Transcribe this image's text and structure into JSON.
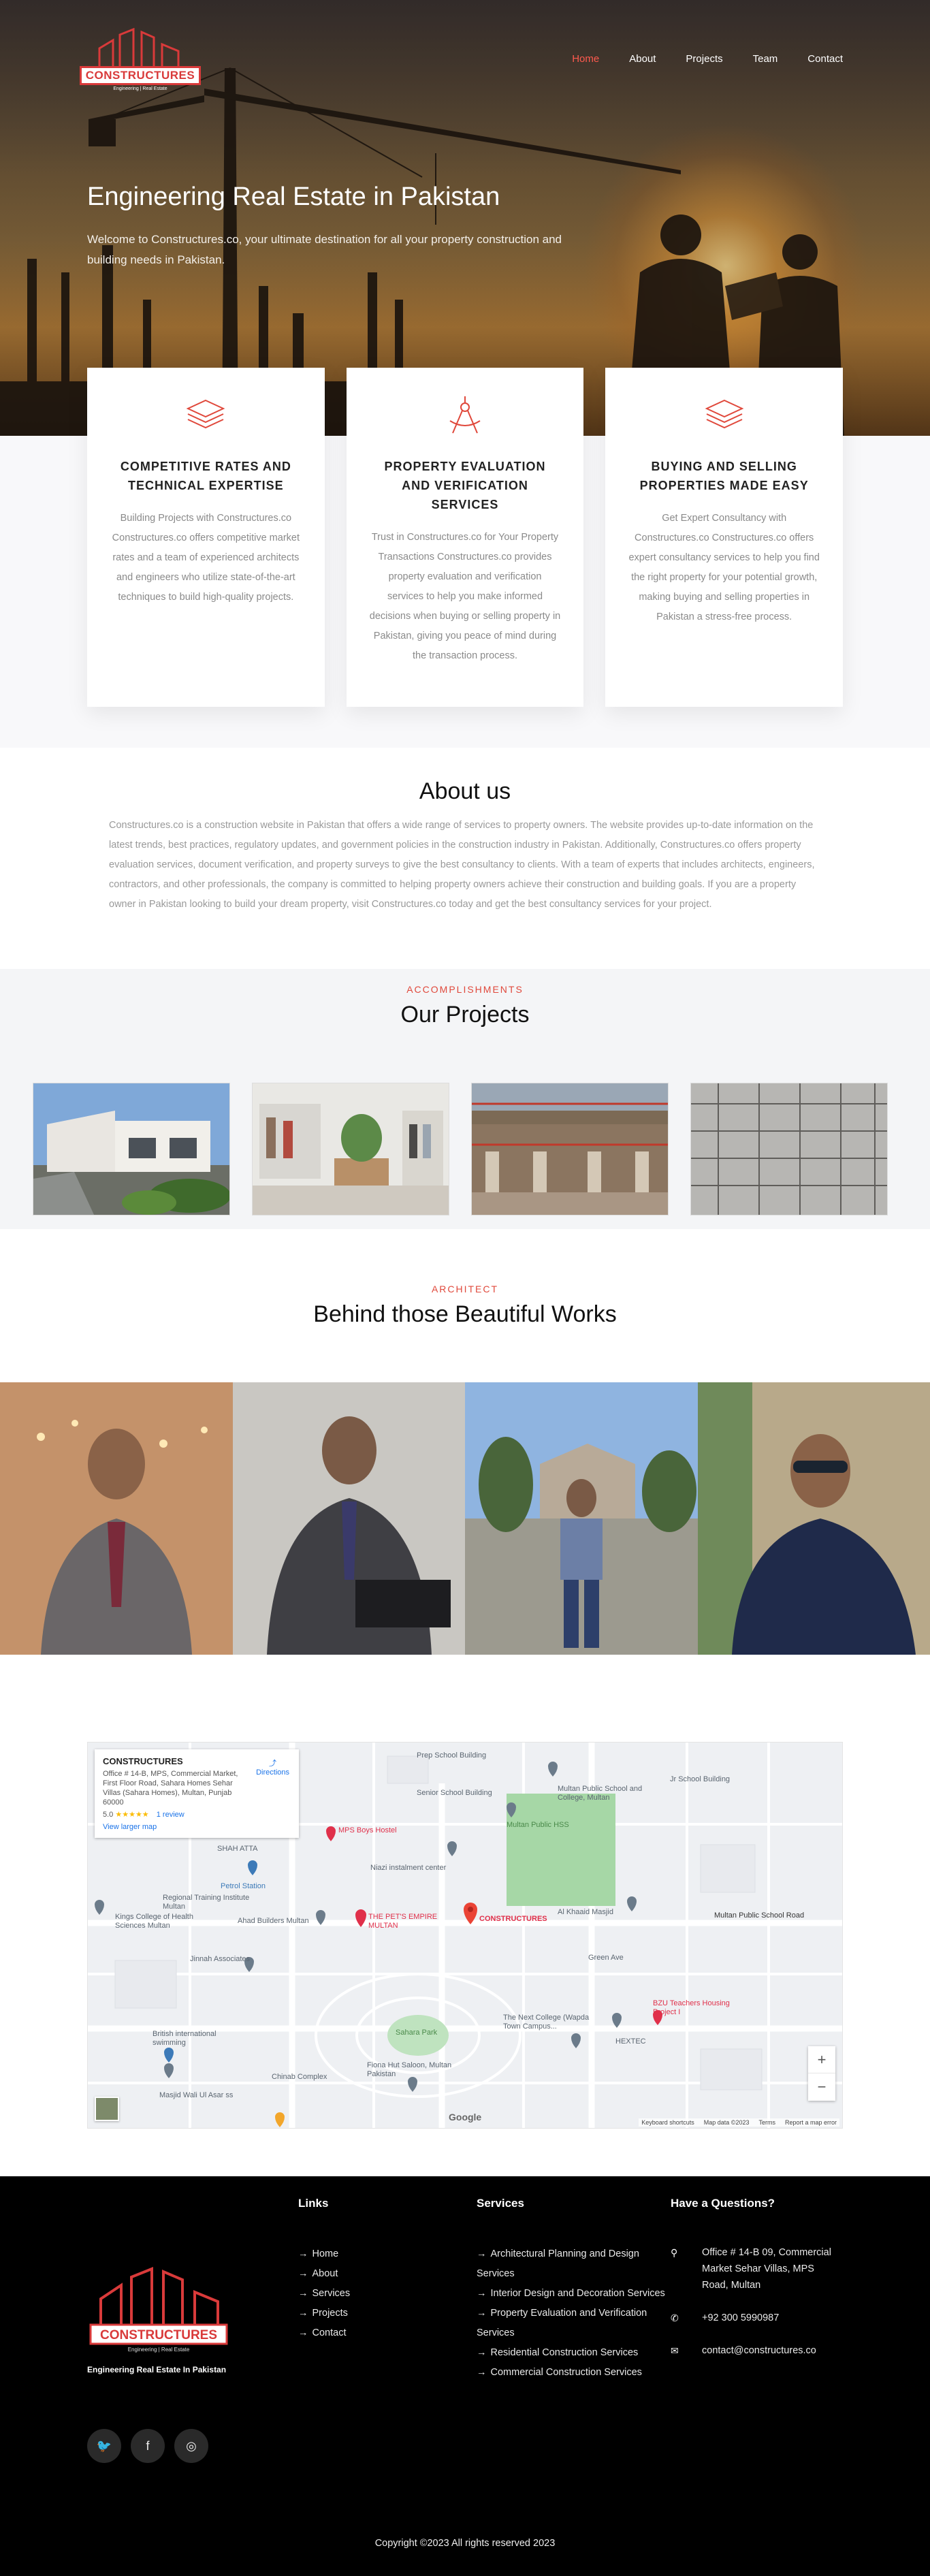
{
  "brand": {
    "logo_word": "CONSTRUCTURES",
    "logo_tagline": "Engineering | Real Estate"
  },
  "nav": {
    "items": [
      {
        "label": "Home",
        "active": true
      },
      {
        "label": "About",
        "active": false
      },
      {
        "label": "Projects",
        "active": false
      },
      {
        "label": "Team",
        "active": false
      },
      {
        "label": "Contact",
        "active": false
      }
    ]
  },
  "hero": {
    "title": "Engineering Real Estate in Pakistan",
    "subtitle": "Welcome to Constructures.co, your ultimate destination for all your property construction and building needs in Pakistan."
  },
  "features": [
    {
      "icon": "layers-icon",
      "title": "COMPETITIVE RATES AND TECHNICAL EXPERTISE",
      "text": "Building Projects with Constructures.co Constructures.co offers competitive market rates and a team of experienced architects and engineers who utilize state-of-the-art techniques to build high-quality projects."
    },
    {
      "icon": "compass-icon",
      "title": "PROPERTY EVALUATION AND VERIFICATION SERVICES",
      "text": "Trust in Constructures.co for Your Property Transactions Constructures.co provides property evaluation and verification services to help you make informed decisions when buying or selling property in Pakistan, giving you peace of mind during the transaction process."
    },
    {
      "icon": "layers-icon",
      "title": "BUYING AND SELLING PROPERTIES MADE EASY",
      "text": "Get Expert Consultancy with Constructures.co Constructures.co offers expert consultancy services to help you find the right property for your potential growth, making buying and selling properties in Pakistan a stress-free process."
    }
  ],
  "about": {
    "title": "About us",
    "text": "Constructures.co is a construction website in Pakistan that offers a wide range of services to property owners. The website provides up-to-date information on the latest trends, best practices, regulatory updates, and government policies in the construction industry in Pakistan. Additionally, Constructures.co offers property evaluation services, document verification, and property surveys to give the best consultancy to clients. With a team of experts that includes architects, engineers, contractors, and other professionals, the company is committed to helping property owners achieve their construction and building goals. If you are a property owner in Pakistan looking to build your dream property, visit Constructures.co today and get the best consultancy services for your project."
  },
  "projects": {
    "eyebrow": "ACCOMPLISHMENTS",
    "title": "Our Projects",
    "items": [
      {
        "name": "project-house"
      },
      {
        "name": "project-showroom"
      },
      {
        "name": "project-construction-site"
      },
      {
        "name": "project-scaffolding"
      }
    ]
  },
  "team": {
    "eyebrow": "ARCHITECT",
    "title": "Behind those Beautiful Works",
    "members": [
      {
        "name": "team-member-1"
      },
      {
        "name": "team-member-2"
      },
      {
        "name": "team-member-3"
      },
      {
        "name": "team-member-4"
      }
    ]
  },
  "map": {
    "place_title": "CONSTRUCTURES",
    "place_address": "Office # 14-B, MPS, Commercial Market, First Floor Road, Sahara Homes Sehar Villas (Sahara Homes), Multan, Punjab 60000",
    "directions": "Directions",
    "rating": "5.0",
    "stars": "★★★★★",
    "reviews": "1 review",
    "larger": "View larger map",
    "labels": {
      "prep": "Prep School Building",
      "senior": "Senior School Building",
      "jr": "Jr School Building",
      "mps_college": "Multan Public School and College, Multan",
      "mps_hss": "Multan Public HSS",
      "boys_hostel": "MPS Boys Hostel",
      "shah_ata": "SHAH ATTA",
      "niazi": "Niazi instalment center",
      "petrol": "Petrol Station",
      "regional": "Regional Training Institute Multan",
      "kings": "Kings College of Health Sciences Multan",
      "ahad": "Ahad Builders Multan",
      "pets": "THE PET'S EMPIRE MULTAN",
      "constructures": "CONSTRUCTURES",
      "arkaaid": "Al Khaaid Masjid",
      "school_road": "Multan Public School Road",
      "jinnah": "Jinnah Associates",
      "green": "Green Ave",
      "next_college": "The Next College (Wapda Town Campus...",
      "bzu": "BZU Teachers Housing Project I",
      "hextec": "HEXTEC",
      "sahara_park": "Sahara Park",
      "british": "British international swimming",
      "chinab": "Chinab Complex",
      "fiona": "Fiona Hut Saloon, Multan Pakistan",
      "masjid_wali": "Masjid Wali Ul Asar ss"
    },
    "footer": [
      "Keyboard shortcuts",
      "Map data ©2023",
      "Terms",
      "Report a map error"
    ],
    "google": "Google",
    "zoom_in": "+",
    "zoom_out": "−"
  },
  "footer": {
    "tagline": "Engineering Real Estate In Pakistan",
    "links_title": "Links",
    "links": [
      "Home",
      "About",
      "Services",
      "Projects",
      "Contact"
    ],
    "services_title": "Services",
    "services": [
      "Architectural Planning and Design Services",
      "Interior Design and Decoration Services",
      "Property Evaluation and Verification Services",
      "Residential Construction Services",
      "Commercial Construction Services"
    ],
    "contact_title": "Have a Questions?",
    "address": "Office # 14-B 09, Commercial Market Sehar Villas, MPS Road, Multan",
    "phone": "+92 300 5990987",
    "email": "contact@constructures.co",
    "arrow": "→",
    "social": [
      {
        "name": "twitter-icon",
        "glyph": "🐦"
      },
      {
        "name": "facebook-icon",
        "glyph": "f"
      },
      {
        "name": "instagram-icon",
        "glyph": "◎"
      }
    ],
    "copyright": "Copyright ©2023 All rights reserved 2023"
  },
  "colors": {
    "accent": "#e0483b",
    "footer_bg": "#000000"
  }
}
